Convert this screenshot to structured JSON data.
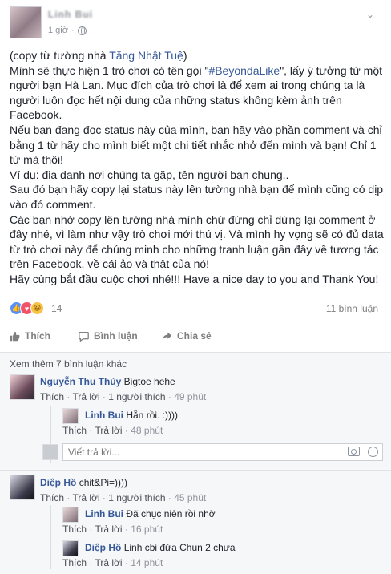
{
  "post": {
    "author": "Linh Bui",
    "time": "1 giờ",
    "paragraphs": [
      {
        "pre": "(copy từ tường nhà ",
        "link": "Tăng Nhật Tuệ",
        "post": ")"
      },
      {
        "pre": "Mình sẽ thực hiện 1 trò chơi có tên gọi \"",
        "link": "#BeyondaLike",
        "post": "\", lấy ý tưởng từ một người bạn Hà Lan. Mục đích của trò chơi là để xem ai trong chúng ta là người luôn đọc hết nội dung của những status không kèm ảnh trên Facebook."
      },
      {
        "pre": "Nếu bạn đang đọc status này của mình, bạn hãy vào phần comment và chỉ bằng 1 từ hãy cho mình biết một chi tiết nhắc nhở đến mình và bạn! Chỉ 1 từ mà thôi!"
      },
      {
        "pre": "Ví dụ: địa danh nơi chúng ta gặp, tên người bạn chung.."
      },
      {
        "pre": "Sau đó bạn hãy copy lại status này lên tường nhà bạn để mình cũng có dịp vào đó comment."
      },
      {
        "pre": "Các bạn nhớ copy lên tường nhà mình chứ đừng chỉ dừng lại comment ở đây nhé, vì làm như vậy trò chơi mới thú vị. Và mình hy vọng sẽ có đủ data từ trò chơi này để chúng minh cho những tranh luận gần đây về tương tác trên Facebook, về cái ảo và thật của nó!"
      },
      {
        "pre": "Hãy cùng bắt đầu cuộc chơi nhé!!! Have a nice day to you and Thank You!"
      }
    ]
  },
  "reactions": {
    "count": "14",
    "comments": "11 bình luận"
  },
  "actions": {
    "like": "Thích",
    "comment": "Bình luận",
    "share": "Chia sẻ"
  },
  "comments": {
    "more": "Xem thêm 7 bình luận khác",
    "items": [
      {
        "name": "Nguyễn Thu Thủy",
        "text": "Bigtoe hehe",
        "like": "Thích",
        "reply": "Trả lời",
        "replies": "1 người thích",
        "time": "49 phút"
      },
      {
        "name": "Linh Bui",
        "text": "Hẵn rồi. :))))",
        "like": "Thích",
        "reply": "Trả lời",
        "time": "48 phút"
      },
      {
        "name": "Diệp Hồ",
        "text": "chit&Pi=))))",
        "like": "Thích",
        "reply": "Trả lời",
        "replies": "1 người thích",
        "time": "45 phút"
      },
      {
        "name": "Linh Bui",
        "text": "Đã chục niên rồi nhờ",
        "like": "Thích",
        "reply": "Trả lời",
        "time": "16 phút"
      },
      {
        "name": "Diệp Hồ",
        "text": "Linh cbi đứa Chun 2 chưa",
        "like": "Thích",
        "reply": "Trả lời",
        "time": "14 phút"
      }
    ],
    "reply_placeholder": "Viết trả lời..."
  },
  "colors": {
    "link": "#365899",
    "like": "#5890ff",
    "love": "#f25268",
    "haha": "#f7c344"
  }
}
